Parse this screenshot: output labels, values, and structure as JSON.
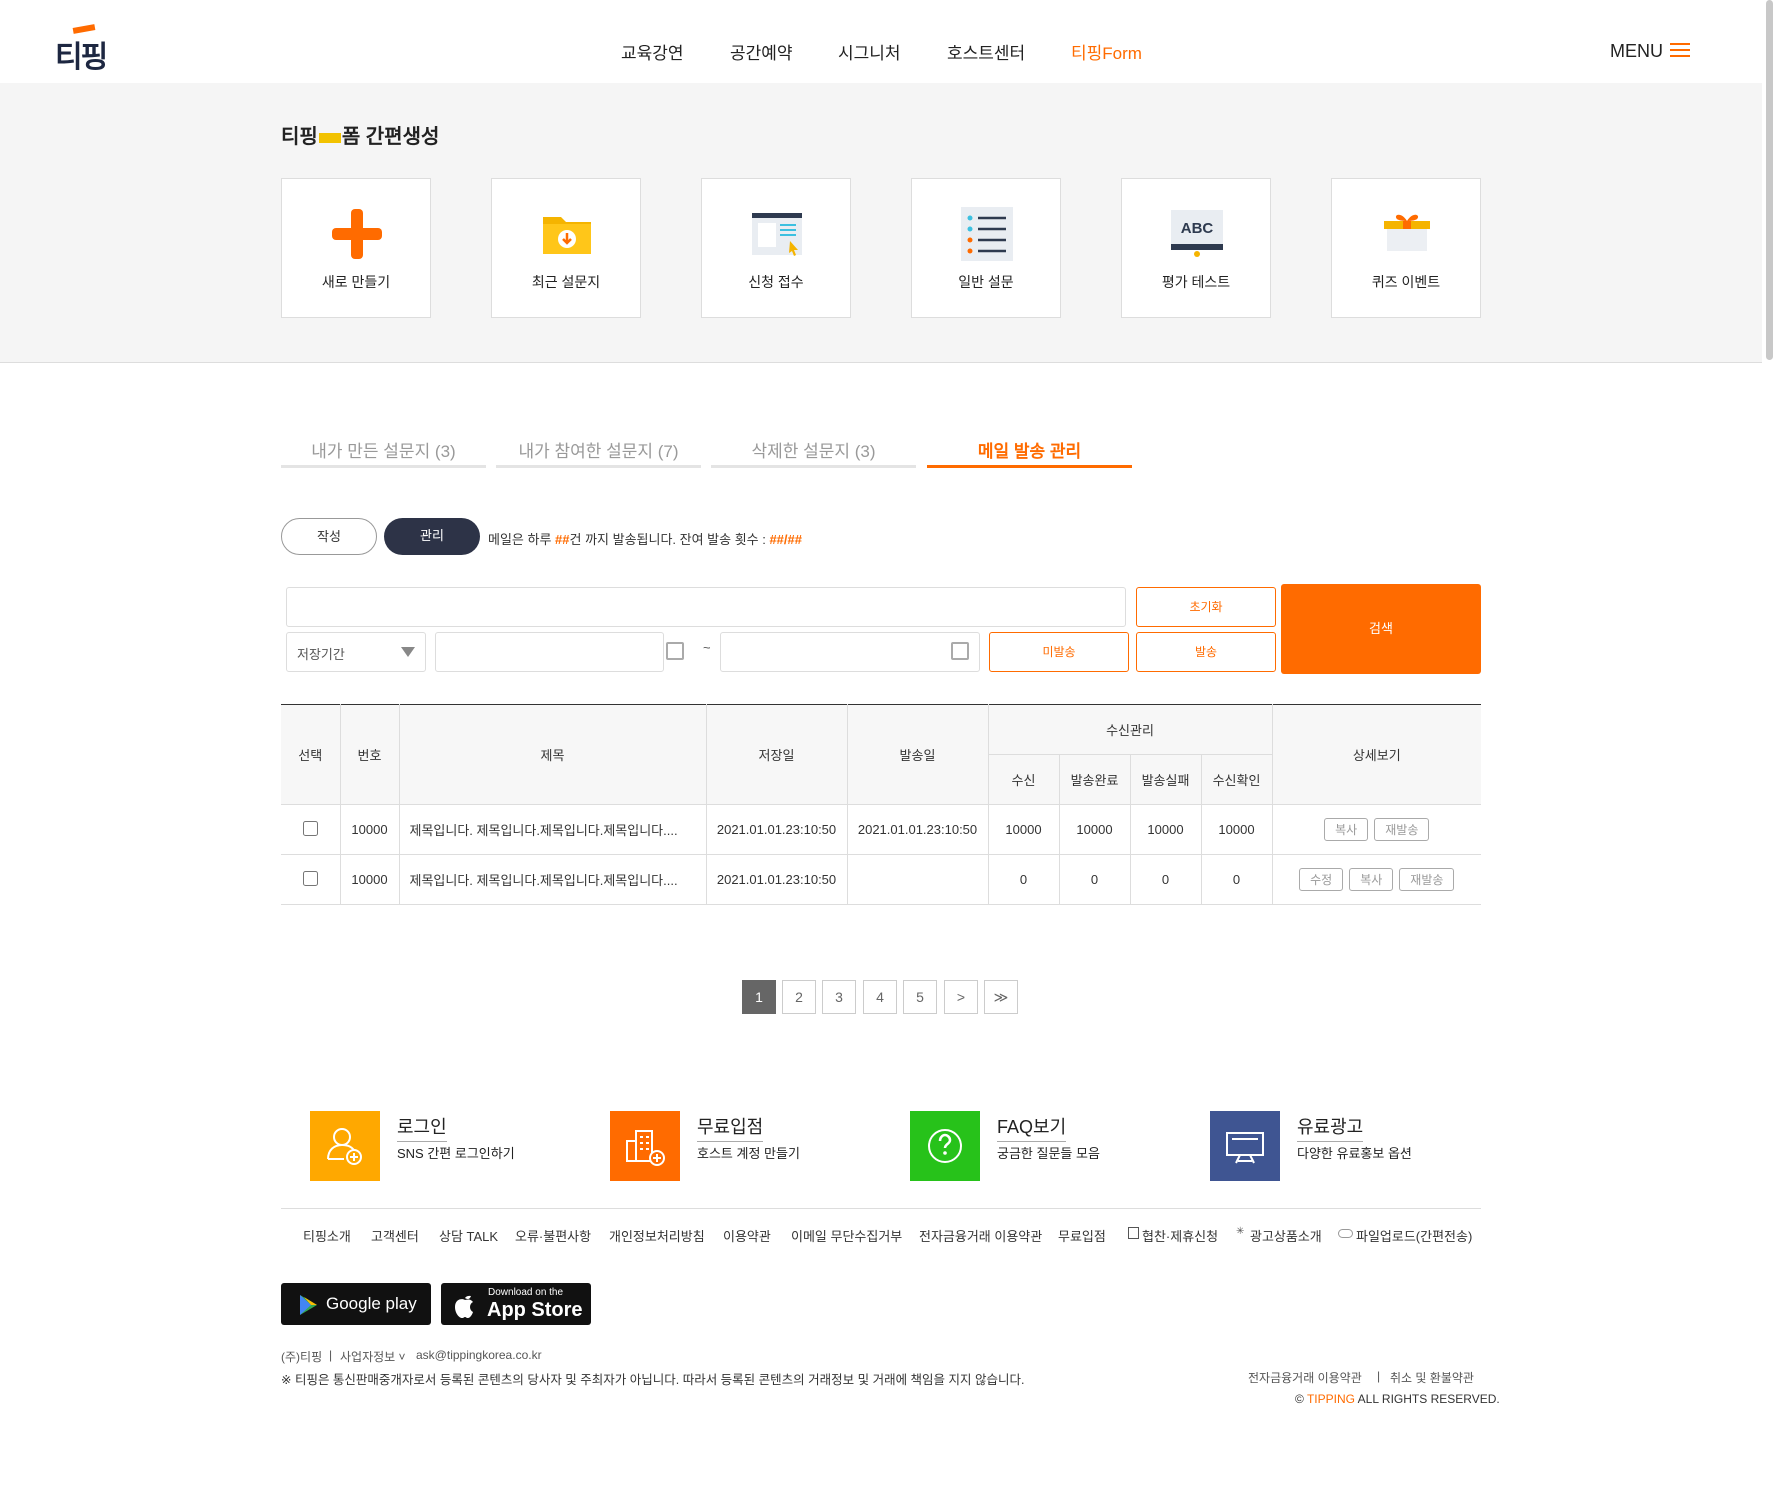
{
  "header": {
    "logo": "티핑",
    "nav": [
      "교육강연",
      "공간예약",
      "시그니처",
      "호스트센터",
      "티핑Form"
    ],
    "menu_label": "MENU",
    "accent": "#ff6b00"
  },
  "quick": {
    "title_left": "티핑",
    "title_right": "폼 간편생성",
    "cards": [
      {
        "label": "새로 만들기",
        "icon": "plus-icon"
      },
      {
        "label": "최근 설문지",
        "icon": "folder-download-icon"
      },
      {
        "label": "신청 접수",
        "icon": "form-window-icon"
      },
      {
        "label": "일반 설문",
        "icon": "list-icon"
      },
      {
        "label": "평가 테스트",
        "icon": "abc-board-icon"
      },
      {
        "label": "퀴즈 이벤트",
        "icon": "gift-icon"
      }
    ]
  },
  "tabs": [
    {
      "label": "내가 만든 설문지 (3)",
      "active": false
    },
    {
      "label": "내가 참여한 설문지 (7)",
      "active": false
    },
    {
      "label": "삭제한 설문지 (3)",
      "active": false
    },
    {
      "label": "메일 발송 관리",
      "active": true
    }
  ],
  "mode": {
    "write_label": "작성",
    "manage_label": "관리",
    "notice_a": "메일은 하루 ",
    "notice_b": "##",
    "notice_c": "건 까지 발송됩니다. 잔여 발송 횟수 : ",
    "notice_d": "##/##"
  },
  "search": {
    "keyword_value": "",
    "period_select": "저장기간",
    "date_separator": "~",
    "reset_label": "초기화",
    "unsent_label": "미발송",
    "sent_label": "발송",
    "search_label": "검색"
  },
  "table": {
    "headers": {
      "select": "선택",
      "no": "번호",
      "title": "제목",
      "saved": "저장일",
      "sent": "발송일",
      "recv_group": "수신관리",
      "recv": "수신",
      "done": "발송완료",
      "fail": "발송실패",
      "confirm": "수신확인",
      "detail": "상세보기"
    },
    "rows": [
      {
        "no": "10000",
        "title": "제목입니다. 제목입니다.제목입니다.제목입니다....",
        "saved": "2021.01.01.23:10:50",
        "sent": "2021.01.01.23:10:50",
        "recv": "10000",
        "done": "10000",
        "fail": "10000",
        "confirm": "10000",
        "actions": [
          "복사",
          "재발송"
        ]
      },
      {
        "no": "10000",
        "title": "제목입니다. 제목입니다.제목입니다.제목입니다....",
        "saved": "2021.01.01.23:10:50",
        "sent": "",
        "recv": "0",
        "done": "0",
        "fail": "0",
        "confirm": "0",
        "actions": [
          "수정",
          "복사",
          "재발송"
        ]
      }
    ]
  },
  "pagination": {
    "pages": [
      "1",
      "2",
      "3",
      "4",
      "5"
    ],
    "current": "1",
    "next": ">",
    "last": "≫"
  },
  "footer": {
    "features": [
      {
        "title": "로그인",
        "sub": "SNS 간편 로그인하기",
        "color": "#ffa800",
        "icon": "user-add-icon"
      },
      {
        "title": "무료입점",
        "sub": "호스트 계정 만들기",
        "color": "#ff6b00",
        "icon": "building-add-icon"
      },
      {
        "title": "FAQ보기",
        "sub": "궁금한 질문들 모음",
        "color": "#27c21a",
        "icon": "question-icon"
      },
      {
        "title": "유료광고",
        "sub": "다양한 유료홍보 옵션",
        "color": "#3f5592",
        "icon": "billboard-icon"
      }
    ],
    "links": [
      "티핑소개",
      "고객센터",
      "상담 TALK",
      "오류·불편사항",
      "개인정보처리방침",
      "이용약관",
      "이메일 무단수집거부",
      "전자금융거래 이용약관",
      "무료입점",
      "협찬·제휴신청",
      "광고상품소개",
      "파일업로드(간편전송)"
    ],
    "google_play": "Google play",
    "app_store_small": "Download on the",
    "app_store": "App Store",
    "company": "(주)티핑",
    "biz_info": "사업자정보 ˅",
    "email": "ask@tippingkorea.co.kr",
    "disclaimer": "※ 티핑은 통신판매중개자로서 등록된 콘텐츠의 당사자 및 주최자가 아닙니다. 따라서 등록된 콘텐츠의 거래정보 및 거래에 책임을 지지 않습니다.",
    "terms1": "전자금융거래 이용약관",
    "terms2": "취소 및 환불약관",
    "copy_symbol": "©",
    "brand": "TIPPING",
    "rights": "ALL RIGHTS RESERVED."
  }
}
